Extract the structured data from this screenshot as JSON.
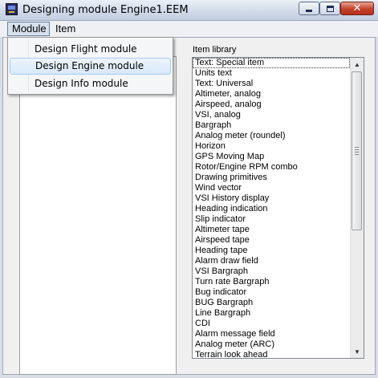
{
  "window": {
    "title": "Designing module Engine1.EEM",
    "close_glyph": "✕"
  },
  "menubar": {
    "items": [
      "Module",
      "Item"
    ]
  },
  "module_menu": {
    "items": [
      "Design Flight module",
      "Design Engine module",
      "Design Info module"
    ],
    "highlighted": "Design Engine module"
  },
  "item_library": {
    "label": "Item library",
    "selected": "Text: Special item",
    "items": [
      "Text: Special item",
      "Units text",
      "Text: Universal",
      "Altimeter, analog",
      "Airspeed, analog",
      "VSI, analog",
      "Bargraph",
      "Analog meter (roundel)",
      "Horizon",
      "GPS Moving Map",
      "Rotor/Engine RPM combo",
      "Drawing primitives",
      "Wind vector",
      "VSI History display",
      "Heading indication",
      "Slip indicator",
      "Altimeter tape",
      "Airspeed tape",
      "Heading tape",
      "Alarm draw field",
      "VSI Bargraph",
      "Turn rate Bargraph",
      "Bug indicator",
      "BUG Bargraph",
      "Line Bargraph",
      "CDI",
      "Alarm message field",
      "Analog meter (ARC)",
      "Terrain look ahead"
    ]
  },
  "colors": {
    "selection_outline": "#333333",
    "menu_highlight": "#d8e8fa",
    "close_button": "#c3412a"
  }
}
